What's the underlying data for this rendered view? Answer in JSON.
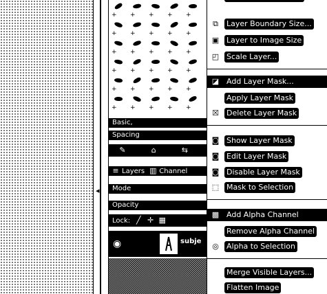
{
  "dock": {
    "brushes_tab": "Basic,",
    "spacing_label": "Spacing",
    "layers_tab": "Layers",
    "channels_tab": "Channel",
    "mode_label": "Mode",
    "opacity_label": "Opacity",
    "lock_label": "Lock:",
    "layer_name": "subje"
  },
  "menu": {
    "top_partial": "",
    "layer_boundary_size": "Layer Boundary Size...",
    "layer_to_image_size": "Layer to Image Size",
    "scale_layer": "Scale Layer...",
    "add_layer_mask": "Add Layer Mask...",
    "apply_layer_mask": "Apply Layer Mask",
    "delete_layer_mask": "Delete Layer Mask",
    "show_layer_mask": "Show Layer Mask",
    "edit_layer_mask": "Edit Layer Mask",
    "disable_layer_mask": "Disable Layer Mask",
    "mask_to_selection": "Mask to Selection",
    "add_alpha_channel": "Add Alpha Channel",
    "remove_alpha_channel": "Remove Alpha Channel",
    "alpha_to_selection": "Alpha to Selection",
    "merge_visible_layers": "Merge Visible Layers...",
    "flatten_image": "Flatten Image"
  }
}
